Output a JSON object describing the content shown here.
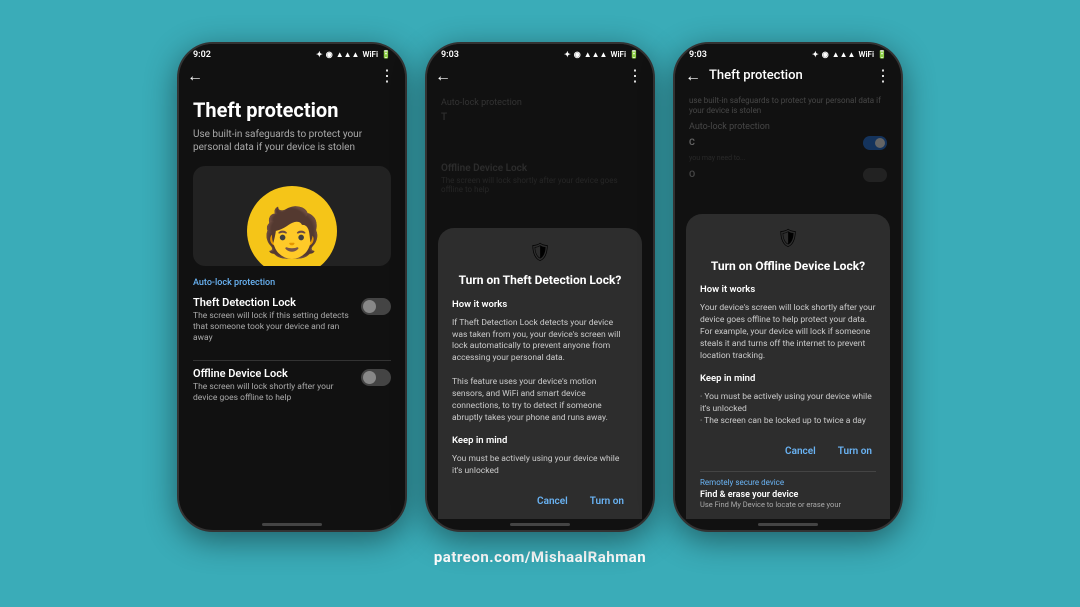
{
  "background_color": "#3aacb8",
  "watermark": "patreon.com/MishaalRahman",
  "phone1": {
    "status_time": "9:02",
    "page_title": "Theft protection",
    "page_subtitle": "Use built-in safeguards to protect your personal data if your device is stolen",
    "section_label": "Auto-lock protection",
    "settings": [
      {
        "name": "Theft Detection Lock",
        "desc": "The screen will lock if this setting detects that someone took your device and ran away",
        "toggle": false
      },
      {
        "name": "Offline Device Lock",
        "desc": "The screen will lock shortly after your device goes offline to help",
        "toggle": false
      }
    ]
  },
  "phone2": {
    "status_time": "9:03",
    "dialog_title": "Turn on Theft Detection Lock?",
    "dialog_icon": "🛡",
    "how_it_works_label": "How it works",
    "how_it_works_body": "If Theft Detection Lock detects your device was taken from you, your device's screen will lock automatically to prevent anyone from accessing your personal data.\n\nThis feature uses your device's motion sensors, and WiFi and smart device connections, to try to detect if someone abruptly takes your phone and runs away.",
    "keep_in_mind_label": "Keep in mind",
    "keep_in_mind_body": "You must be actively using your device while it's unlocked",
    "cancel_label": "Cancel",
    "turn_on_label": "Turn on",
    "bg_section_label": "Auto-lock protection",
    "bg_setting_name_partial": "T",
    "bg_offline_label": "Offline Device Lock",
    "bg_offline_desc": "The screen will lock shortly after your device goes offline to help"
  },
  "phone3": {
    "status_time": "9:03",
    "nav_title": "Theft protection",
    "dialog_title": "Turn on Offline Device Lock?",
    "dialog_icon": "🛡",
    "how_it_works_label": "How it works",
    "how_it_works_body": "Your device's screen will lock shortly after your device goes offline to help protect your data. For example, your device will lock if someone steals it and turns off the internet to prevent location tracking.",
    "keep_in_mind_label": "Keep in mind",
    "keep_in_mind_items": [
      "You must be actively using your device while it's unlocked",
      "The screen can be locked up to twice a day"
    ],
    "cancel_label": "Cancel",
    "turn_on_label": "Turn on",
    "remote_section_label": "Remotely secure device",
    "find_erase_title": "Find & erase your device",
    "find_erase_desc": "Use Find My Device to locate or erase your"
  }
}
